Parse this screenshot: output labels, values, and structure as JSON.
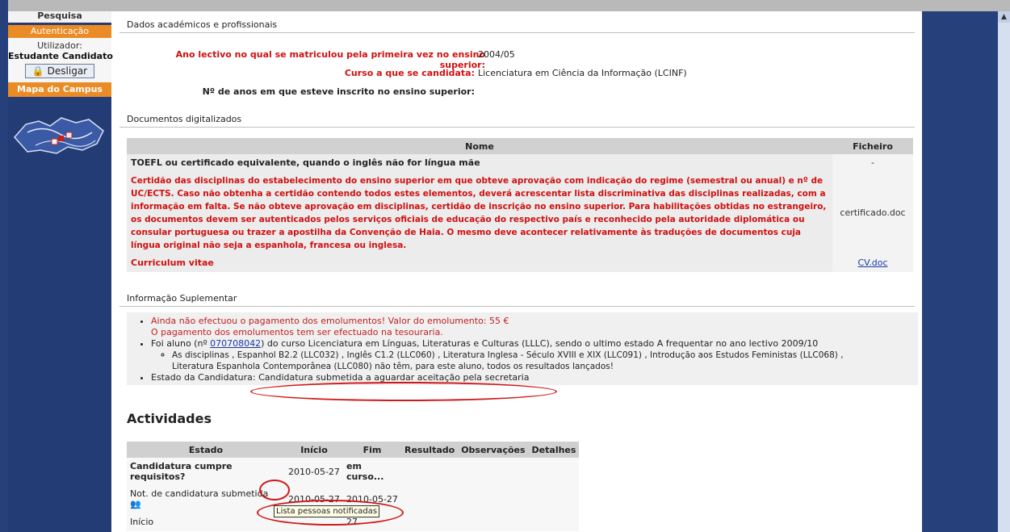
{
  "sidebar": {
    "search_label": "Pesquisa",
    "auth_header": "Autenticação",
    "user_label": "Utilizador:",
    "user_name": "Estudante Candidato",
    "logout_label": "Desligar",
    "map_header": "Mapa do Campus"
  },
  "academic": {
    "section_title": "Dados académicos e profissionais",
    "year_label": "Ano lectivo no qual se matriculou pela primeira vez no ensino superior:",
    "year_value": "2004/05",
    "course_label": "Curso a que se candidata:",
    "course_value": "Licenciatura em Ciência da Informação (LCINF)",
    "years_label": "Nº de anos em que esteve inscrito no ensino superior:",
    "years_value": ""
  },
  "documents": {
    "section_title": "Documentos digitalizados",
    "col_name": "Nome",
    "col_file": "Ficheiro",
    "rows": [
      {
        "name": "TOEFL ou certificado equivalente, quando o inglês não for língua mãe",
        "file": "-"
      },
      {
        "name": "Certidão das disciplinas do estabelecimento do ensino superior em que obteve aprovação com indicação do regime (semestral ou anual) e nº de UC/ECTS. Caso não obtenha a certidão contendo todos estes elementos, deverá acrescentar lista discriminativa das disciplinas realizadas, com a informação em falta. Se não obteve aprovação em disciplinas, certidão de inscrição no ensino superior. Para habilitações obtidas no estrangeiro, os documentos devem ser autenticados pelos serviços oficiais de educação do respectivo país e reconhecido pela autoridade diplomática ou consular portuguesa ou trazer a apostilha da Convenção de Haia. O mesmo deve acontecer relativamente às traduções de documentos cuja língua original não seja a espanhola, francesa ou inglesa.",
        "file": "certificado.doc"
      },
      {
        "name": "Curriculum vitae",
        "file": "CV.doc"
      }
    ]
  },
  "supplementary": {
    "section_title": "Informação Suplementar",
    "payment_warning": "Ainda não efectuou o pagamento dos emolumentos! Valor do emolumento: 55 €",
    "payment_note": "O pagamento dos emolumentos tem ser efectuado na tesouraria.",
    "former_prefix": "Foi aluno (nº ",
    "student_number": "070708042",
    "former_suffix": ") do curso Licenciatura em Línguas, Literaturas e Culturas (LLLC), sendo o ultimo estado A frequentar no ano lectivo 2009/10",
    "disciplines_line1": "As disciplinas , Espanhol B2.2 (LLC032) , Inglês C1.2 (LLC060) , Literatura Inglesa - Século XVIII e XIX (LLC091) , Introdução aos Estudos Feministas (LLC068) ,",
    "disciplines_line2": "Literatura Espanhola Contemporânea (LLC080) não têm, para este aluno, todos os resultados lançados!",
    "status_label": "Estado da Candidatura:",
    "status_value": "Candidatura submetida a aguardar aceitação pela secretaria"
  },
  "activities": {
    "title": "Actividades",
    "headers": [
      "Estado",
      "Início",
      "Fim",
      "Resultado",
      "Observações",
      "Detalhes"
    ],
    "rows": [
      {
        "estado": "Candidatura cumpre requisitos?",
        "inicio": "2010-05-27",
        "fim": "em curso..."
      },
      {
        "estado": "Not. de candidatura submetida",
        "inicio": "2010-05-27",
        "fim": "2010-05-27"
      },
      {
        "estado": "Início",
        "inicio": "",
        "fim": "27"
      }
    ],
    "tooltip": "Lista pessoas notificadas"
  },
  "colors": {
    "accent_red": "#d01010",
    "sidebar_blue": "#233c75",
    "orange": "#ea8b25"
  }
}
